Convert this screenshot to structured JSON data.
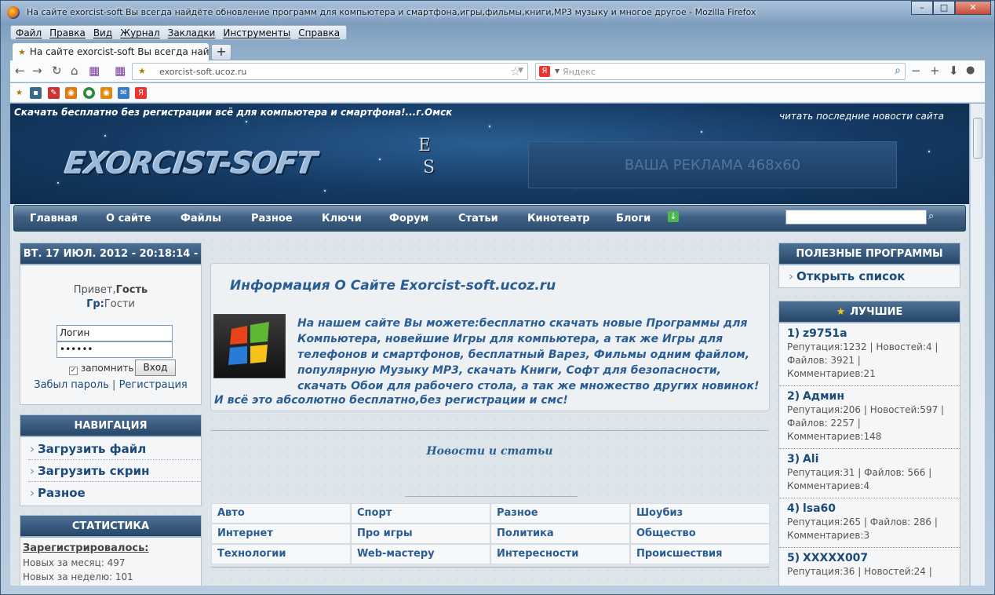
{
  "window": {
    "title": "На сайте exorcist-soft Вы всегда найдёте обновление программ для компьютера и смартфона,игры,фильмы,книги,MP3 музыку и многое другое - Mozilla Firefox",
    "controls": {
      "minimize": "–",
      "maximize": "□",
      "close": "✕"
    }
  },
  "menu": [
    "Файл",
    "Правка",
    "Вид",
    "Журнал",
    "Закладки",
    "Инструменты",
    "Справка"
  ],
  "tabs": [
    {
      "label": "На сайте exorcist-soft Вы всегда найд..."
    }
  ],
  "newtab_label": "+",
  "address": {
    "url": "exorcist-soft.ucoz.ru"
  },
  "search": {
    "placeholder": "Яндекс"
  },
  "site": {
    "tagline": "Скачать бесплатно без регистрации всё для компьютера и смартфона!...г.Омск",
    "latest_link": "читать последние новости сайта",
    "logo": "EXORCIST-SOFT",
    "logo_mark_top": "E",
    "logo_mark_bottom": "S",
    "ad": "ВАША РЕКЛАМА 468x60",
    "nav": [
      "Главная",
      "О сайте",
      "Файлы",
      "Разное",
      "Ключи",
      "Форум",
      "Статьи",
      "Кинотеатр",
      "Блоги"
    ]
  },
  "left": {
    "date": "ВТ. 17 ИЮЛ. 2012 - 20:18:14 -",
    "greeting_prefix": "Привет,",
    "greeting_name": "Гость",
    "group_prefix": "Гр:",
    "group_name": "Гости",
    "login_value": "Логин",
    "password_value": "••••••",
    "remember_label": "запомнить",
    "login_button": "Вход",
    "forgot_link": "Забыл пароль",
    "separator": "|",
    "register_link": "Регистрация",
    "nav_title": "НАВИГАЦИЯ",
    "nav_items": [
      "Загрузить файл",
      "Загрузить скрин",
      "Разное"
    ],
    "stats_title": "СТАТИСТИКА",
    "stats_registered": "Зарегистрировалось:",
    "stats_lines": [
      "Новых за месяц: 497",
      "Новых за неделю: 101"
    ]
  },
  "main": {
    "info_title": "Информация О Сайте Exorcist-soft.ucoz.ru",
    "info_text": "На нашем сайте Вы можете:бесплатно скачать новые Программы для Компьютера, новейшие Игры для компьютера, а так же Игры для телефонов и смартфонов, бесплатный Варез, Фильмы одним файлом, популярную Музыку MP3, скачать Книги, Софт для безопасности, скачать Обои для рабочего стола, а так же множество других новинок!",
    "info_last": "И всё это абсолютно бесплатно,без регистрации и смс!",
    "news_title": "Новости и статьи",
    "categories": [
      "Авто",
      "Спорт",
      "Разное",
      "Шоубиз",
      "Интернет",
      "Про игры",
      "Политика",
      "Общество",
      "Технологии",
      "Web-мастеру",
      "Интересности",
      "Происшествия"
    ]
  },
  "right": {
    "useful_title": "ПОЛЕЗНЫЕ ПРОГРАММЫ",
    "useful_link": "Открыть список",
    "best_title": "ЛУЧШИЕ",
    "best": [
      {
        "rank": "1)",
        "name": "z9751a",
        "lines": "Репутация:1232 | Новостей:4 | Файлов: 3921 | Комментариев:21"
      },
      {
        "rank": "2)",
        "name": "Админ",
        "lines": "Репутация:206 | Новостей:597 | Файлов: 2257 | Комментариев:148"
      },
      {
        "rank": "3)",
        "name": "Ali",
        "lines": "Репутация:31 | Файлов: 566 | Комментариев:4"
      },
      {
        "rank": "4)",
        "name": "lsa60",
        "lines": "Репутация:265 | Файлов: 286 | Комментариев:3"
      },
      {
        "rank": "5)",
        "name": "XXXXX007",
        "lines": "Репутация:36 | Новостей:24 |"
      }
    ]
  },
  "icons": {
    "firefox": "firefox-icon",
    "back": "back-arrow-icon",
    "forward": "forward-arrow-icon",
    "reload": "reload-icon",
    "home": "home-icon"
  },
  "colors": {
    "accent": "#2a5d93",
    "header_bg": "#143a63",
    "nav_bg": "#3f6185"
  }
}
